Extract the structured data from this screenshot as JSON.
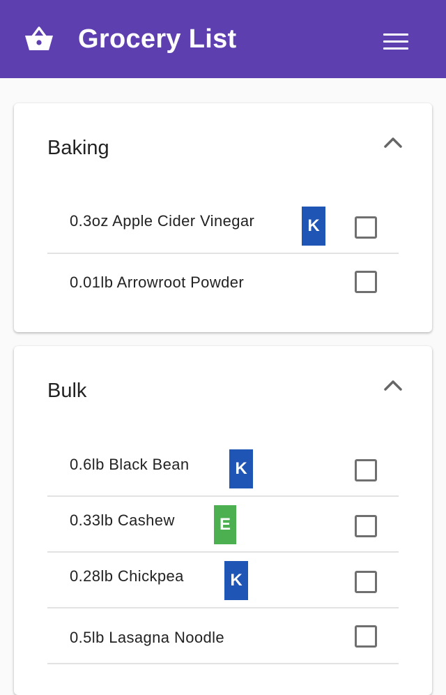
{
  "appbar": {
    "title": "Grocery List",
    "icon": "shopping-basket-icon",
    "menu_icon": "hamburger-menu-icon",
    "background_color": "#5e3fb0"
  },
  "colors": {
    "badge_K": "#1f56b5",
    "badge_E": "#4caf50"
  },
  "categories": [
    {
      "title": "Baking",
      "expanded": true,
      "items": [
        {
          "label": "0.3oz Apple Cider Vinegar",
          "badge": "K",
          "checked": false
        },
        {
          "label": "0.01lb Arrowroot Powder",
          "badge": "",
          "checked": false
        }
      ]
    },
    {
      "title": "Bulk",
      "expanded": true,
      "items": [
        {
          "label": "0.6lb Black Bean",
          "badge": "K",
          "checked": false
        },
        {
          "label": "0.33lb Cashew",
          "badge": "E",
          "checked": false
        },
        {
          "label": "0.28lb Chickpea",
          "badge": "K",
          "checked": false
        },
        {
          "label": "0.5lb Lasagna Noodle",
          "badge": "",
          "checked": false
        }
      ]
    }
  ]
}
